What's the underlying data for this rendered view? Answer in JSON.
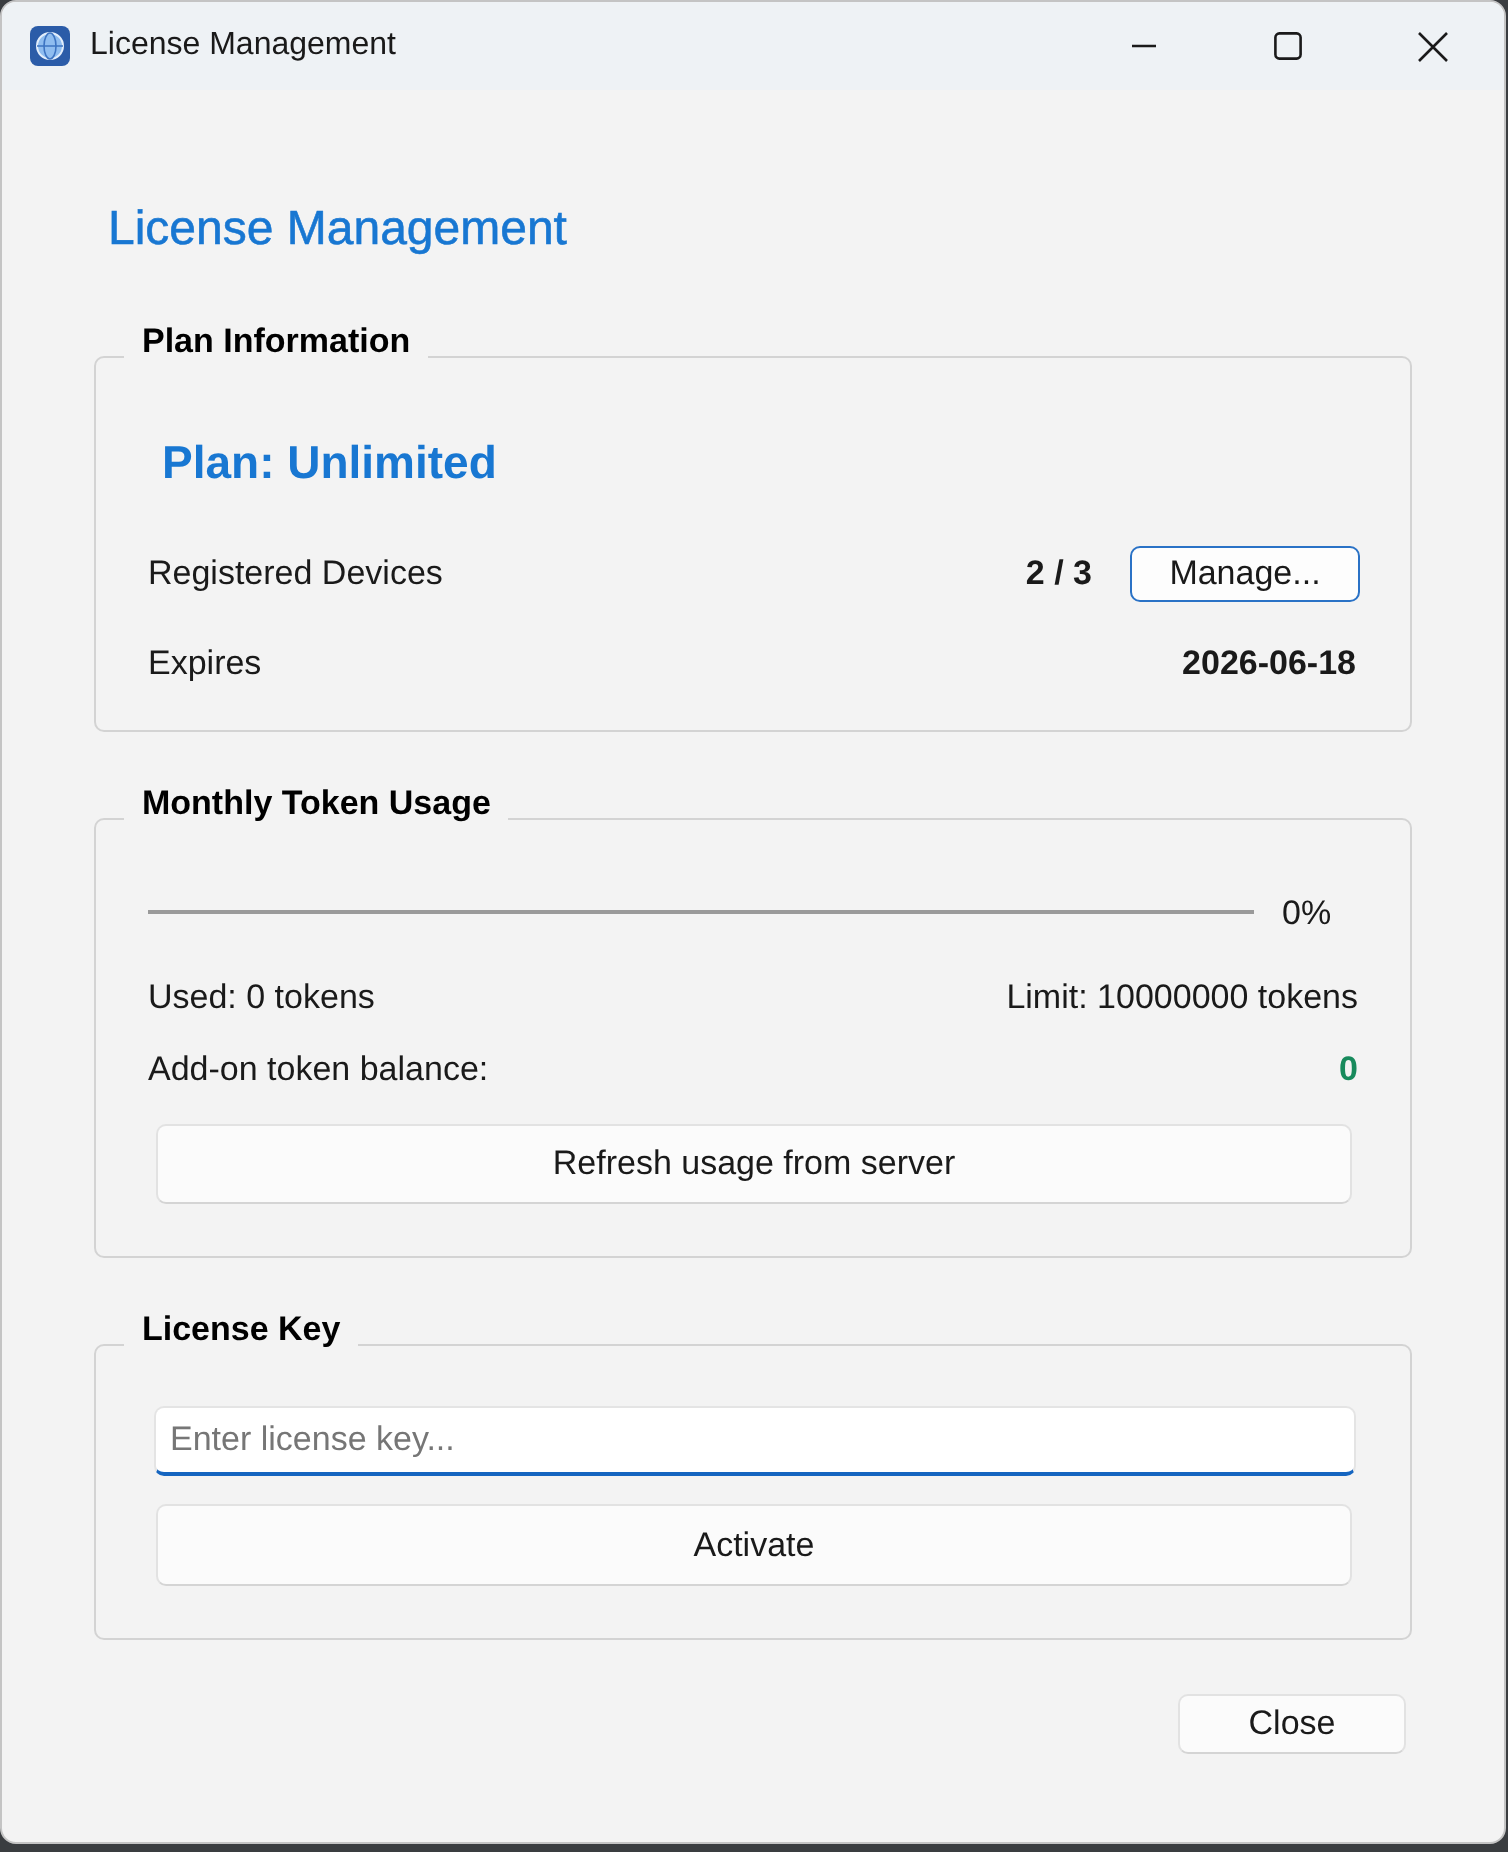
{
  "window": {
    "title": "License Management"
  },
  "heading": "License Management",
  "plan_information": {
    "title": "Plan Information",
    "plan": "Plan: Unlimited",
    "rows": [
      {
        "label": "Registered Devices",
        "value": "2 / 3",
        "button": "Manage..."
      },
      {
        "label": "Expires",
        "value": "2026-06-18"
      }
    ]
  },
  "monthly_token_usage": {
    "title": "Monthly Token Usage",
    "progress": {
      "level": 0,
      "reading": "0%"
    },
    "used": "Used: 0 tokens",
    "limit": "Limit: 10000000 tokens",
    "add_on_balance": {
      "label": "Add-on token balance:",
      "value": "0"
    },
    "button": "Refresh usage from server"
  },
  "license_key": {
    "title": "License Key",
    "input": {
      "placeholder": "Enter license key...",
      "focused": true
    },
    "button": "Activate"
  },
  "buttons": [
    "Close"
  ]
}
